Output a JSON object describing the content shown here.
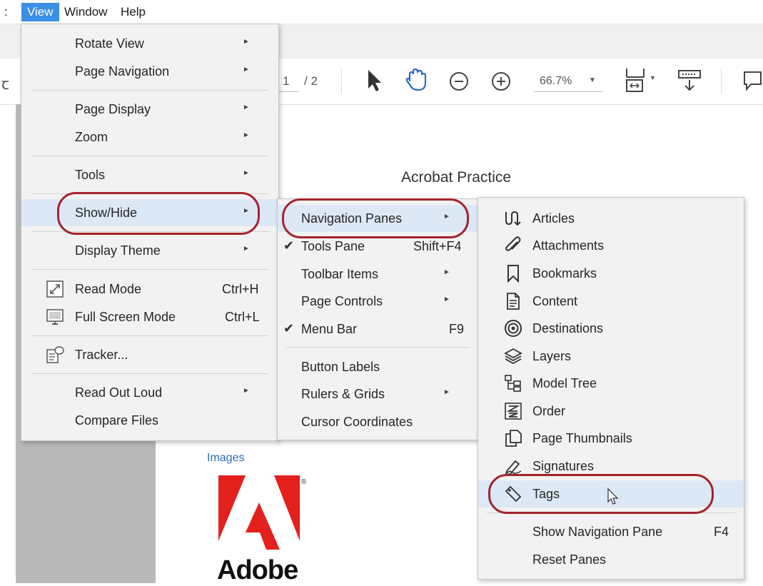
{
  "menubar": {
    "colon": ":",
    "items": [
      "View",
      "Window",
      "Help"
    ],
    "active": "View"
  },
  "toolbar": {
    "page_current": "1",
    "page_total": "/ 2",
    "zoom": "66.7%"
  },
  "document": {
    "title": "Acrobat Practice",
    "images_label": "Images",
    "adobe_word": "Adobe"
  },
  "view_menu": {
    "rotate_view": "Rotate View",
    "page_navigation": "Page Navigation",
    "page_display": "Page Display",
    "zoom": "Zoom",
    "tools": "Tools",
    "show_hide": "Show/Hide",
    "display_theme": "Display Theme",
    "read_mode": "Read Mode",
    "read_mode_shortcut": "Ctrl+H",
    "full_screen_mode": "Full Screen Mode",
    "full_screen_shortcut": "Ctrl+L",
    "tracker": "Tracker...",
    "read_out_loud": "Read Out Loud",
    "compare_files": "Compare Files"
  },
  "show_hide_menu": {
    "navigation_panes": "Navigation Panes",
    "tools_pane": "Tools Pane",
    "tools_pane_shortcut": "Shift+F4",
    "toolbar_items": "Toolbar Items",
    "page_controls": "Page Controls",
    "menu_bar": "Menu Bar",
    "menu_bar_shortcut": "F9",
    "button_labels": "Button Labels",
    "rulers_grids": "Rulers & Grids",
    "cursor_coordinates": "Cursor Coordinates"
  },
  "nav_panes_menu": {
    "articles": "Articles",
    "attachments": "Attachments",
    "bookmarks": "Bookmarks",
    "content": "Content",
    "destinations": "Destinations",
    "layers": "Layers",
    "model_tree": "Model Tree",
    "order": "Order",
    "page_thumbnails": "Page Thumbnails",
    "signatures": "Signatures",
    "tags": "Tags",
    "show_navigation_pane": "Show Navigation Pane",
    "show_navigation_pane_shortcut": "F4",
    "reset_panes": "Reset Panes"
  },
  "colors": {
    "highlight_oval": "#a4242b",
    "menubar_active": "#3c8fe6",
    "menu_hover": "#dce8f6",
    "adobe_red": "#e4201c"
  }
}
